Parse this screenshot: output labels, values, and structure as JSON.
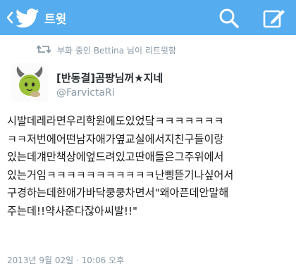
{
  "colors": {
    "header_bg": "#55acee",
    "header_fg": "#ffffff",
    "muted_text": "#8899a6",
    "body_text": "#1a1a1a"
  },
  "header": {
    "back_icon": "chevron-left-icon",
    "logo_icon": "twitter-bird-icon",
    "title": "트윗",
    "search_icon": "search-icon",
    "compose_icon": "compose-icon"
  },
  "retweet": {
    "icon": "retweet-icon",
    "text": "부화 중인 Bettina 님이 리트윗함"
  },
  "author": {
    "avatar_icon": "avatar-horned-character",
    "display_name": "[반동결]곰팡님꺼★지네",
    "handle": "@FarvictaRi"
  },
  "tweet": {
    "lines": [
      "시발데레라면우리학원에도있었닼ㅋㅋㅋㅋㅋㅋㅋ",
      "ㅋㅋ저번에어떤남자애가옆교실에서지친구들이랑",
      "있는데걔만책상에엎드려있고딴애들은그주위에서",
      "있는거임ㅋㅋㅋㅋㅋㅋㅋㅋㅋㅋㅋ난삥뜯기나싶어서",
      "구경하는데한애가바닥쿵쿵차면서\"왜아픈데안말해",
      "주는데!!약사준다잖아씨발!!\""
    ]
  },
  "timestamp": "2013년 9월 02일 · 10:06 오후"
}
